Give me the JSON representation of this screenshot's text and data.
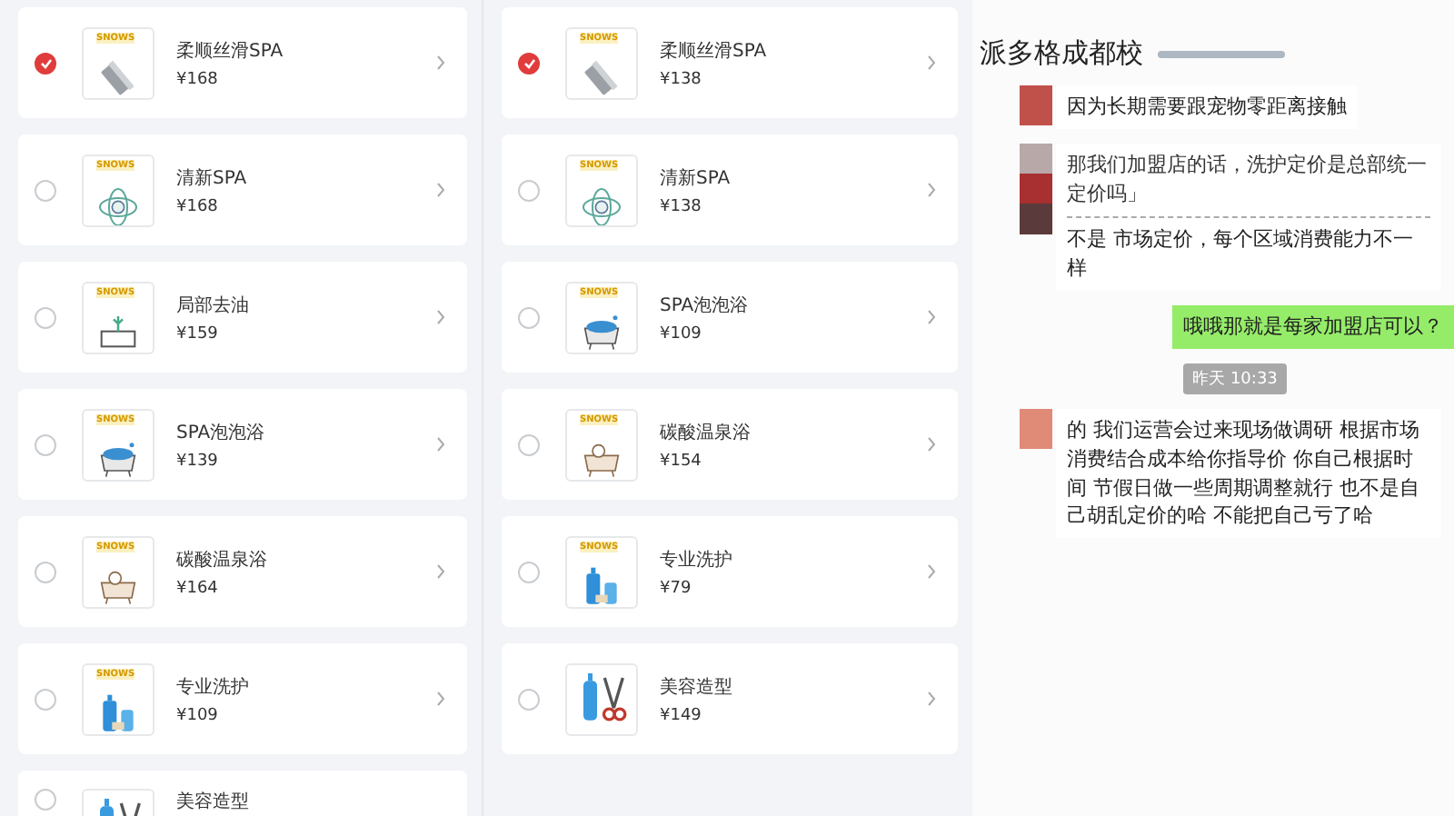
{
  "columns": [
    {
      "items": [
        {
          "name": "柔顺丝滑SPA",
          "price": "¥168",
          "selected": true,
          "logo": "SNOWS",
          "kind": "comb"
        },
        {
          "name": "清新SPA",
          "price": "¥168",
          "selected": false,
          "logo": "SNOWS",
          "kind": "sheep"
        },
        {
          "name": "局部去油",
          "price": "¥159",
          "selected": false,
          "logo": "SNOWS",
          "kind": "sink"
        },
        {
          "name": "SPA泡泡浴",
          "price": "¥139",
          "selected": false,
          "logo": "SNOWS",
          "kind": "bubble_bath"
        },
        {
          "name": "碳酸温泉浴",
          "price": "¥164",
          "selected": false,
          "logo": "SNOWS",
          "kind": "tub"
        },
        {
          "name": "专业洗护",
          "price": "¥109",
          "selected": false,
          "logo": "SNOWS",
          "kind": "bottles"
        },
        {
          "name": "美容造型",
          "selected": false,
          "kind": "scissors"
        }
      ]
    },
    {
      "items": [
        {
          "name": "柔顺丝滑SPA",
          "price": "¥138",
          "selected": true,
          "logo": "SNOWS",
          "kind": "comb"
        },
        {
          "name": "清新SPA",
          "price": "¥138",
          "selected": false,
          "logo": "SNOWS",
          "kind": "sheep"
        },
        {
          "name": "SPA泡泡浴",
          "price": "¥109",
          "selected": false,
          "logo": "SNOWS",
          "kind": "bubble_bath"
        },
        {
          "name": "碳酸温泉浴",
          "price": "¥154",
          "selected": false,
          "logo": "SNOWS",
          "kind": "tub"
        },
        {
          "name": "专业洗护",
          "price": "¥79",
          "selected": false,
          "logo": "SNOWS",
          "kind": "bottles"
        },
        {
          "name": "美容造型",
          "price": "¥149",
          "selected": false,
          "kind": "scissors"
        }
      ]
    }
  ],
  "chat": {
    "title": "派多格成都校",
    "messages": [
      {
        "kind": "incoming",
        "text": "因为长期需要跟宠物零距离接触"
      },
      {
        "kind": "quote_reply",
        "quote": "那我们加盟店的话，洗护定价是总部统一定价吗」",
        "text": "不是  市场定价，每个区域消费能力不一样"
      },
      {
        "kind": "outgoing",
        "text": "哦哦那就是每家加盟店可以？"
      },
      {
        "kind": "time",
        "text": "昨天 10:33"
      },
      {
        "kind": "incoming",
        "text": "的  我们运营会过来现场做调研  根据市场消费结合成本给你指导价  你自己根据时间  节假日做一些周期调整就行  也不是自己胡乱定价的哈  不能把自己亏了哈"
      }
    ]
  }
}
